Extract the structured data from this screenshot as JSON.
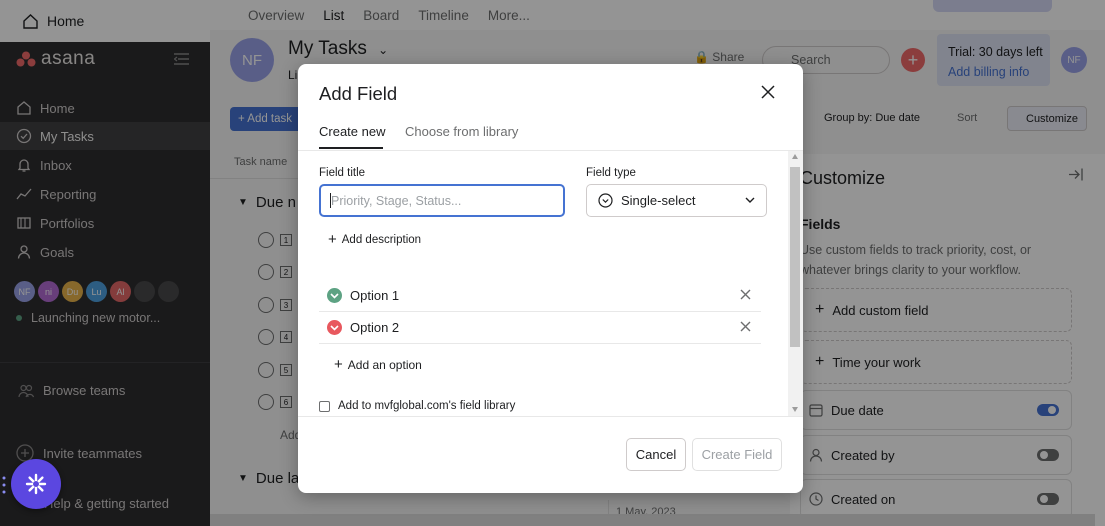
{
  "sidebar": {
    "top_home": "Home",
    "logo_text": "asana",
    "items": [
      {
        "label": "Home",
        "icon": "home-icon"
      },
      {
        "label": "My Tasks",
        "icon": "check-circle-icon",
        "active": true
      },
      {
        "label": "Inbox",
        "icon": "bell-icon"
      },
      {
        "label": "Reporting",
        "icon": "chart-line-icon"
      },
      {
        "label": "Portfolios",
        "icon": "folder-icon"
      },
      {
        "label": "Goals",
        "icon": "person-icon"
      }
    ],
    "avatars": [
      {
        "initials": "NF",
        "color": "#9aa3e8"
      },
      {
        "initials": "ni",
        "color": "#b36bd4"
      },
      {
        "initials": "Du",
        "color": "#e8b44a"
      },
      {
        "initials": "Lu",
        "color": "#4ea1e0"
      },
      {
        "initials": "Al",
        "color": "#e36868"
      },
      {
        "initials": "",
        "color": "#49494b"
      },
      {
        "initials": "",
        "color": "#49494b"
      }
    ],
    "project": "Launching new motor...",
    "browse_teams": "Browse teams",
    "invite": "Invite teammates",
    "help": "Help & getting started"
  },
  "tabs": [
    "Overview",
    "List",
    "Board",
    "Timeline",
    "More..."
  ],
  "active_tab": "List",
  "header": {
    "avatar": "NF",
    "title": "My Tasks",
    "subtitle": "Li",
    "share": "Share",
    "search_placeholder": "Search",
    "trial_line1": "Trial: 30 days left",
    "trial_line2": "Add billing info",
    "user_avatar": "NF"
  },
  "toolbar": {
    "add_task": "+ Add task",
    "group_by": "Group by: Due date",
    "sort": "Sort",
    "customize": "Customize"
  },
  "list": {
    "column_task": "Task name",
    "section1": "Due n",
    "rows": [
      "1",
      "2",
      "3",
      "4",
      "5",
      "6"
    ],
    "add_row": "Add",
    "section2": "Due la",
    "date_cell": "1 May, 2023"
  },
  "customize_panel": {
    "title": "Customize",
    "fields_heading": "Fields",
    "description": "Use custom fields to track priority, cost, or whatever brings clarity to your workflow.",
    "add_custom_field": "Add custom field",
    "time_your_work": "Time your work",
    "rows": [
      {
        "label": "Due date",
        "on": true,
        "icon": "calendar-icon"
      },
      {
        "label": "Created by",
        "on": false,
        "icon": "person-icon"
      },
      {
        "label": "Created on",
        "on": false,
        "icon": "clock-icon"
      }
    ]
  },
  "modal": {
    "title": "Add Field",
    "tabs": [
      "Create new",
      "Choose from library"
    ],
    "active_tab": "Create new",
    "field_title_label": "Field title",
    "field_title_placeholder": "Priority, Stage, Status...",
    "field_type_label": "Field type",
    "field_type_value": "Single-select",
    "add_description": "Add description",
    "options": [
      {
        "label": "Option 1",
        "color": "#5da283"
      },
      {
        "label": "Option 2",
        "color": "#e8585e"
      }
    ],
    "add_option": "Add an option",
    "library_checkbox": "Add to mvfglobal.com's field library",
    "cancel": "Cancel",
    "create": "Create Field"
  }
}
